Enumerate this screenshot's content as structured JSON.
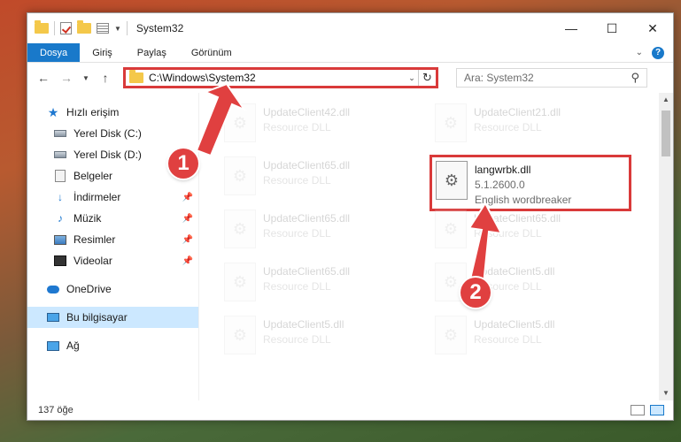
{
  "window": {
    "title": "System32",
    "minimize": "—",
    "maximize": "☐",
    "close": "✕"
  },
  "ribbon": {
    "tabs": [
      {
        "label": "Dosya"
      },
      {
        "label": "Giriş"
      },
      {
        "label": "Paylaş"
      },
      {
        "label": "Görünüm"
      }
    ]
  },
  "nav": {
    "address": "C:\\Windows\\System32",
    "search_placeholder": "Ara: System32"
  },
  "sidebar": {
    "items": [
      {
        "label": "Hızlı erişim"
      },
      {
        "label": "Yerel Disk (C:)"
      },
      {
        "label": "Yerel Disk (D:)"
      },
      {
        "label": "Belgeler"
      },
      {
        "label": "İndirmeler"
      },
      {
        "label": "Müzik"
      },
      {
        "label": "Resimler"
      },
      {
        "label": "Videolar"
      },
      {
        "label": "OneDrive"
      },
      {
        "label": "Bu bilgisayar"
      },
      {
        "label": "Ağ"
      }
    ]
  },
  "files": [
    {
      "name": "UpdateClient42.dll",
      "sub": "Resource DLL"
    },
    {
      "name": "UpdateClient21.dll",
      "sub": "Resource DLL"
    },
    {
      "name": "UpdateClient65.dll",
      "sub": "Resource DLL"
    },
    {
      "name": "langwrbk.dll",
      "version": "5.1.2600.0",
      "description": "English wordbreaker"
    },
    {
      "name": "UpdateClient65.dll",
      "sub": "Resource DLL"
    },
    {
      "name": "UpdateClient65.dll",
      "sub": "Resource DLL"
    },
    {
      "name": "UpdateClient65.dll",
      "sub": "Resource DLL"
    },
    {
      "name": "UpdateClient5.dll",
      "sub": "Resource DLL"
    },
    {
      "name": "UpdateClient5.dll",
      "sub": "Resource DLL"
    },
    {
      "name": "UpdateClient5.dll",
      "sub": "Resource DLL"
    }
  ],
  "status": {
    "count": "137 öğe"
  },
  "callouts": {
    "one": "1",
    "two": "2"
  },
  "colors": {
    "highlight": "#d93a3a",
    "accent": "#1979ca"
  }
}
